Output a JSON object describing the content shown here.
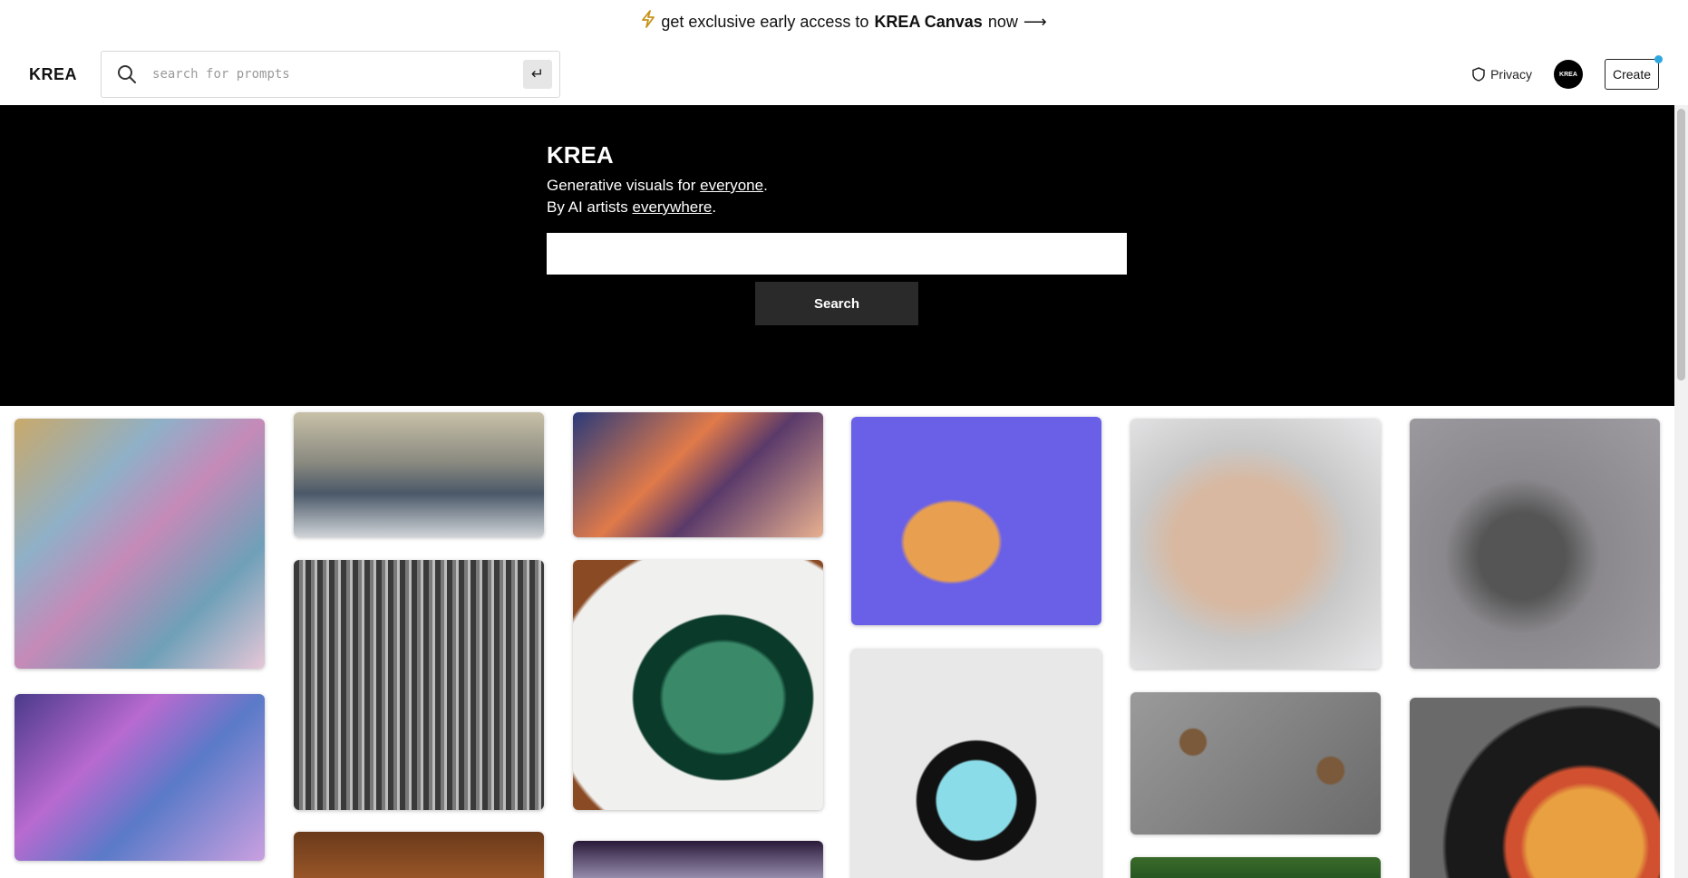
{
  "banner": {
    "prefix": "get exclusive early access to",
    "highlight": "KREA Canvas",
    "suffix": "now",
    "arrow": "⟶"
  },
  "header": {
    "logo": "KREA",
    "search_placeholder": "search for prompts",
    "enter_key": "↵",
    "privacy_label": "Privacy",
    "avatar_text": "KREA",
    "create_label": "Create",
    "notify_color": "#2ea7e0"
  },
  "hero": {
    "title": "KREA",
    "line1_prefix": "Generative visuals for ",
    "line1_link": "everyone",
    "line1_suffix": ".",
    "line2_prefix": "By AI artists ",
    "line2_link": "everywhere",
    "line2_suffix": ".",
    "search_value": "",
    "search_button": "Search"
  },
  "gallery": [
    {
      "name": "fairy-collage-image",
      "bg": "linear-gradient(135deg,#c9a96a 0%,#8fb0c8 30%,#c58ab8 50%,#6fa0b8 75%,#e6c7d8 100%)"
    },
    {
      "name": "fantasy-princess-collage-image",
      "bg": "linear-gradient(135deg,#4a3a8a 0%,#b86ad0 35%,#5a7ac8 60%,#caa0e0 100%)"
    },
    {
      "name": "winter-river-landscape-image",
      "bg": "linear-gradient(180deg,#c8c0a8 0%,#8a8a80 40%,#4a5868 65%,#d0d4d8 100%)"
    },
    {
      "name": "gothic-ornament-pattern-image",
      "bg": "repeating-linear-gradient(90deg,#3a3a3a 0 6px,#7a7a7a 6px 10px,#bdbdbd 10px 13px)"
    },
    {
      "name": "bookshelf-image",
      "bg": "linear-gradient(180deg,#6a3a1a,#a05a2a)"
    },
    {
      "name": "dragon-sunset-image",
      "bg": "linear-gradient(135deg,#2a3a7a 0%,#e07a4a 40%,#5a3a6a 60%,#e8b090 100%)"
    },
    {
      "name": "framed-leaves-image",
      "bg": "radial-gradient(ellipse at 60% 55%,#3a8a6a 0 28%,#0a3a2a 30% 42%,#f0f0ee 43% 80%,#8a4a24 82%)"
    },
    {
      "name": "cosmic-light-image",
      "bg": "linear-gradient(180deg,#2a1a3a,#c8c0e0)"
    },
    {
      "name": "cartoon-dogs-image",
      "bg": "radial-gradient(ellipse at 40% 60%,#e8a050 0 22%,#6a60e8 24%)"
    },
    {
      "name": "cartoon-bearded-face-image",
      "bg": "radial-gradient(circle at 50% 62%,#8adce8 0 20%,#111 21% 30%,#e8e8e8 31%)"
    },
    {
      "name": "woman-portrait-image",
      "bg": "radial-gradient(ellipse at 45% 50%,#d8b8a0 0 35%,#c8c8c8 55%,#e8e8ea 100%)"
    },
    {
      "name": "teddy-bears-concrete-image",
      "bg": "radial-gradient(circle at 25% 35%,#7a5a3a 0 6%,transparent 7%),radial-gradient(circle at 80% 55%,#7a5a3a 0 6%,transparent 7%),linear-gradient(135deg,#9a9a9a,#6a6a6a)"
    },
    {
      "name": "forest-image",
      "bg": "linear-gradient(180deg,#3a6a2a,#1a4a1a)"
    },
    {
      "name": "octopus-sculpture-image",
      "bg": "radial-gradient(ellipse at 45% 55%,#555 0 22%,#8a888c 40%,#9e9ca0 100%)"
    },
    {
      "name": "spaghetti-plate-image",
      "bg": "radial-gradient(circle at 70% 75%,#e8a040 0 25%,#d05030 28% 34%,#1a1a1a 36% 60%,#6a6a6a 62%)"
    }
  ]
}
